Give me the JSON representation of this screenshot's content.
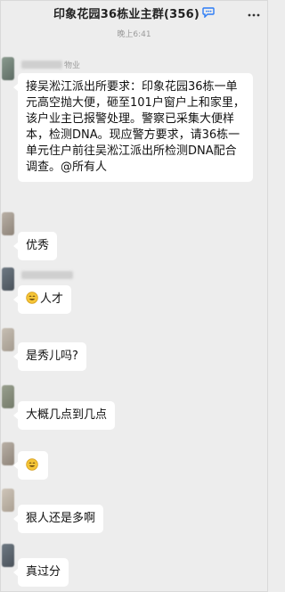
{
  "header": {
    "title": "印象花园36栋业主群(356)",
    "chat_icon": "speech-bubble-icon",
    "more_icon": "ellipsis-icon"
  },
  "timestamp": "晚上6:41",
  "messages": [
    {
      "sender": "物业",
      "text": "接吴淞江派出所要求：印象花园36栋一单元高空抛大便，砸至101户窗户上和家里，该户业主已报警处理。警察已采集大便样本，检测DNA。现应警方要求，请36栋一单元住户前往吴淞江派出所检测DNA配合调查。@所有人"
    },
    {
      "text": "优秀"
    },
    {
      "emoji": "smile-emoji",
      "text": "人才"
    },
    {
      "text": "是秀儿吗?"
    },
    {
      "text": "大概几点到几点"
    },
    {
      "emoji": "smile-emoji",
      "text": ""
    },
    {
      "text": "狠人还是多啊"
    },
    {
      "text": "真过分"
    }
  ],
  "colors": {
    "background": "#ededed",
    "bubble": "#ffffff",
    "accent_icon": "#2d7df6"
  }
}
